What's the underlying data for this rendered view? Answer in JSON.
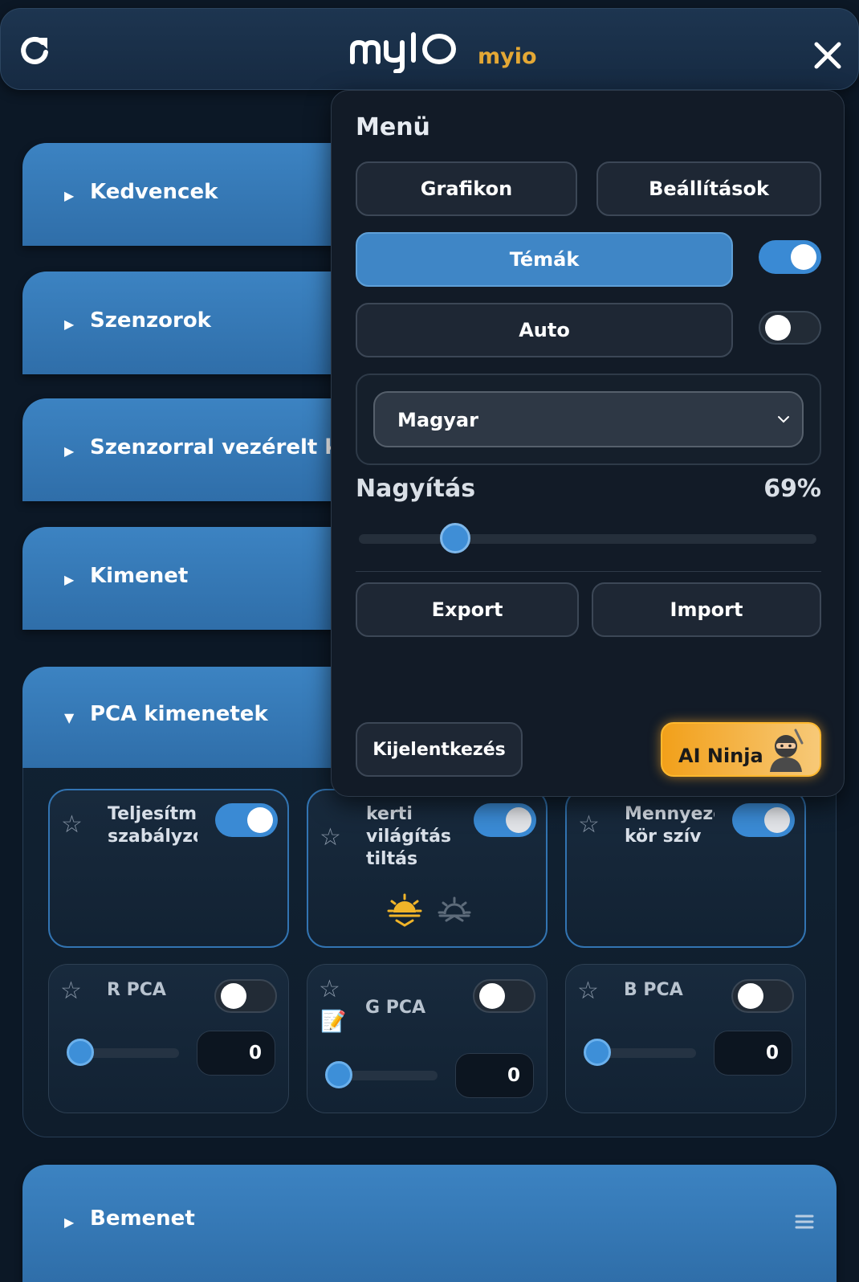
{
  "header": {
    "logo": "myIO",
    "username": "myio",
    "icons": [
      "refresh-icon",
      "close-icon"
    ]
  },
  "sections": [
    {
      "label": "Kedvencek"
    },
    {
      "label": "Szenzorok"
    },
    {
      "label": "Szenzorral vezérelt kimenetek"
    },
    {
      "label": "Kimenet"
    }
  ],
  "pca": {
    "label": "PCA kimenetek",
    "relays": [
      {
        "name": "Teljesítmény szabályzó",
        "state": "on"
      },
      {
        "name": "kerti világítás tiltás",
        "state": "on"
      },
      {
        "name": "Mennyezet kör szív",
        "state": "on"
      }
    ],
    "channels": [
      {
        "name": "R PCA",
        "value": "0",
        "state": "off"
      },
      {
        "name": "G PCA",
        "value": "0",
        "state": "off"
      },
      {
        "name": "B PCA",
        "value": "0",
        "state": "off"
      }
    ],
    "sun_icons": [
      "sunrise-icon",
      "sunset-icon"
    ]
  },
  "bemenet": {
    "label": "Bemenet"
  },
  "menu": {
    "title": "Menü",
    "graph_label": "Grafikon",
    "settings_label": "Beállítások",
    "themes_label": "Témák",
    "themes_on": true,
    "auto_label": "Auto",
    "auto_on": false,
    "language": "Magyar",
    "zoom_label": "Nagyítás",
    "zoom_value": "69%",
    "zoom_fraction": 0.21,
    "export_label": "Export",
    "import_label": "Import",
    "logout_label": "Kijelentkezés",
    "ai_label": "AI Ninja"
  },
  "colors": {
    "accent": "#3c83c2",
    "background": "#0c1826",
    "toggle_on": "#3a8ad4",
    "brand_user": "#e4a835",
    "ai_button": "#f2a01a",
    "sun_active": "#f0b429"
  }
}
